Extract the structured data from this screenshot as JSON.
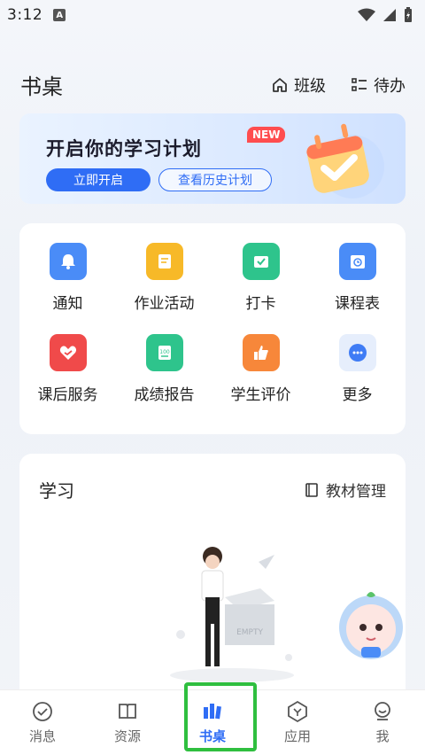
{
  "status": {
    "time": "3:12",
    "notif_letter": "A"
  },
  "header": {
    "title": "书桌",
    "class_label": "班级",
    "todo_label": "待办"
  },
  "banner": {
    "title": "开启你的学习计划",
    "badge": "NEW",
    "start_label": "立即开启",
    "history_label": "查看历史计划"
  },
  "grid": [
    {
      "label": "通知",
      "icon": "bell-icon",
      "color": "#4a8cf7"
    },
    {
      "label": "作业活动",
      "icon": "notepad-icon",
      "color": "#f7b928"
    },
    {
      "label": "打卡",
      "icon": "checkin-icon",
      "color": "#2ec48c"
    },
    {
      "label": "课程表",
      "icon": "calendar-icon",
      "color": "#4a8cf7"
    },
    {
      "label": "课后服务",
      "icon": "heart-service-icon",
      "color": "#f04a4a"
    },
    {
      "label": "成绩报告",
      "icon": "score-report-icon",
      "color": "#2ec48c"
    },
    {
      "label": "学生评价",
      "icon": "thumbs-up-icon",
      "color": "#f7873a"
    },
    {
      "label": "更多",
      "icon": "more-icon",
      "color": "#3f7cf5"
    }
  ],
  "study": {
    "title": "学习",
    "textbook_label": "教材管理",
    "empty_box_text": "EMPTY"
  },
  "tabs": [
    {
      "label": "消息",
      "icon": "message-icon"
    },
    {
      "label": "资源",
      "icon": "resource-icon"
    },
    {
      "label": "书桌",
      "icon": "desk-icon",
      "active": true
    },
    {
      "label": "应用",
      "icon": "app-icon"
    },
    {
      "label": "我",
      "icon": "profile-icon"
    }
  ]
}
